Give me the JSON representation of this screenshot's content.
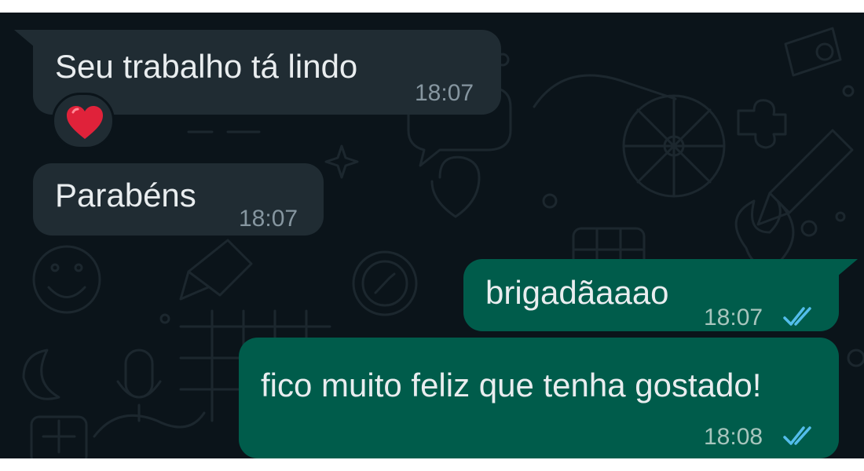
{
  "chat": {
    "messages": [
      {
        "direction": "incoming",
        "text": "Seu trabalho tá lindo",
        "time": "18:07"
      },
      {
        "direction": "incoming",
        "text": "Parabéns",
        "time": "18:07"
      },
      {
        "direction": "outgoing",
        "text": "brigadãaaao",
        "time": "18:07",
        "status": "read-double-check-icon"
      },
      {
        "direction": "outgoing",
        "text": "fico muito feliz que tenha gostado!",
        "time": "18:08",
        "status": "read-double-check-icon"
      }
    ],
    "reaction": {
      "icon": "heart-emoji-icon",
      "color": "#e0223a"
    }
  },
  "theme": {
    "background": "#0b141a",
    "incoming_bubble": "#202c33",
    "outgoing_bubble": "#005c4b",
    "read_tick": "#53bdeb"
  }
}
